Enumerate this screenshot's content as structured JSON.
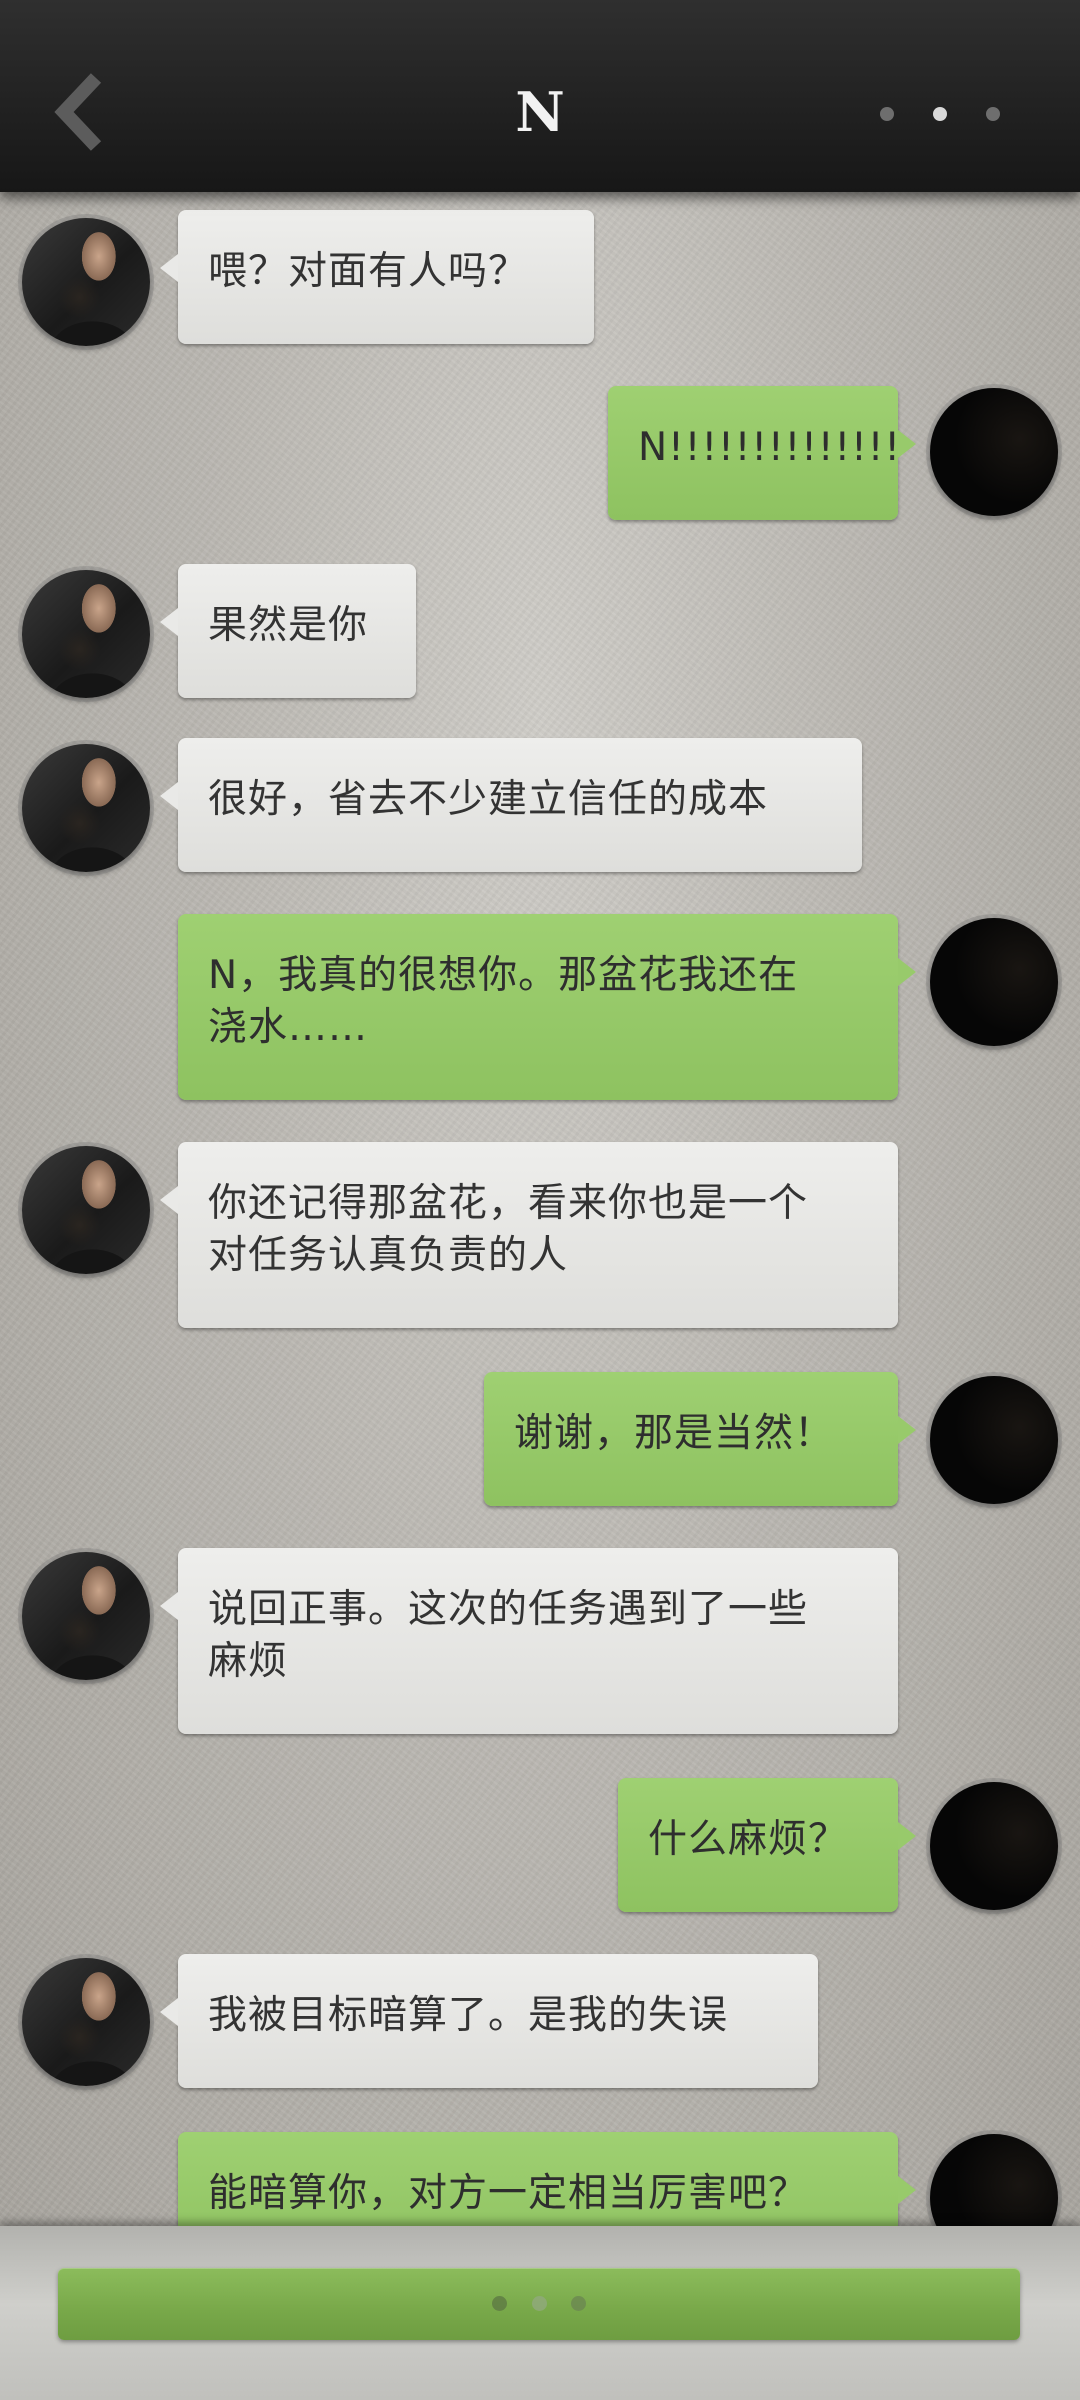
{
  "header": {
    "title": "N",
    "back_icon": "chevron-left-icon",
    "more_icon": "more-dots-icon"
  },
  "messages": [
    {
      "from": "contact",
      "text": "喂？对面有人吗？"
    },
    {
      "from": "me",
      "text": "N!!!!!!!!!!!!!!"
    },
    {
      "from": "contact",
      "text": "果然是你"
    },
    {
      "from": "contact",
      "text": "很好，省去不少建立信任的成本"
    },
    {
      "from": "me",
      "text": "N，我真的很想你。那盆花我还在\n浇水……"
    },
    {
      "from": "contact",
      "text": "你还记得那盆花，看来你也是一个\n对任务认真负责的人"
    },
    {
      "from": "me",
      "text": "谢谢，那是当然！"
    },
    {
      "from": "contact",
      "text": "说回正事。这次的任务遇到了一些\n麻烦"
    },
    {
      "from": "me",
      "text": "什么麻烦？"
    },
    {
      "from": "contact",
      "text": "我被目标暗算了。是我的失误"
    },
    {
      "from": "me",
      "text": "能暗算你，对方一定相当厉害吧？"
    }
  ],
  "footer": {
    "reply_icon": "typing-dots-icon"
  },
  "colors": {
    "incoming_bubble": "#e6e6e4",
    "outgoing_bubble": "#96c869",
    "header_bg": "#222222",
    "reply_button": "#7aab4b"
  }
}
